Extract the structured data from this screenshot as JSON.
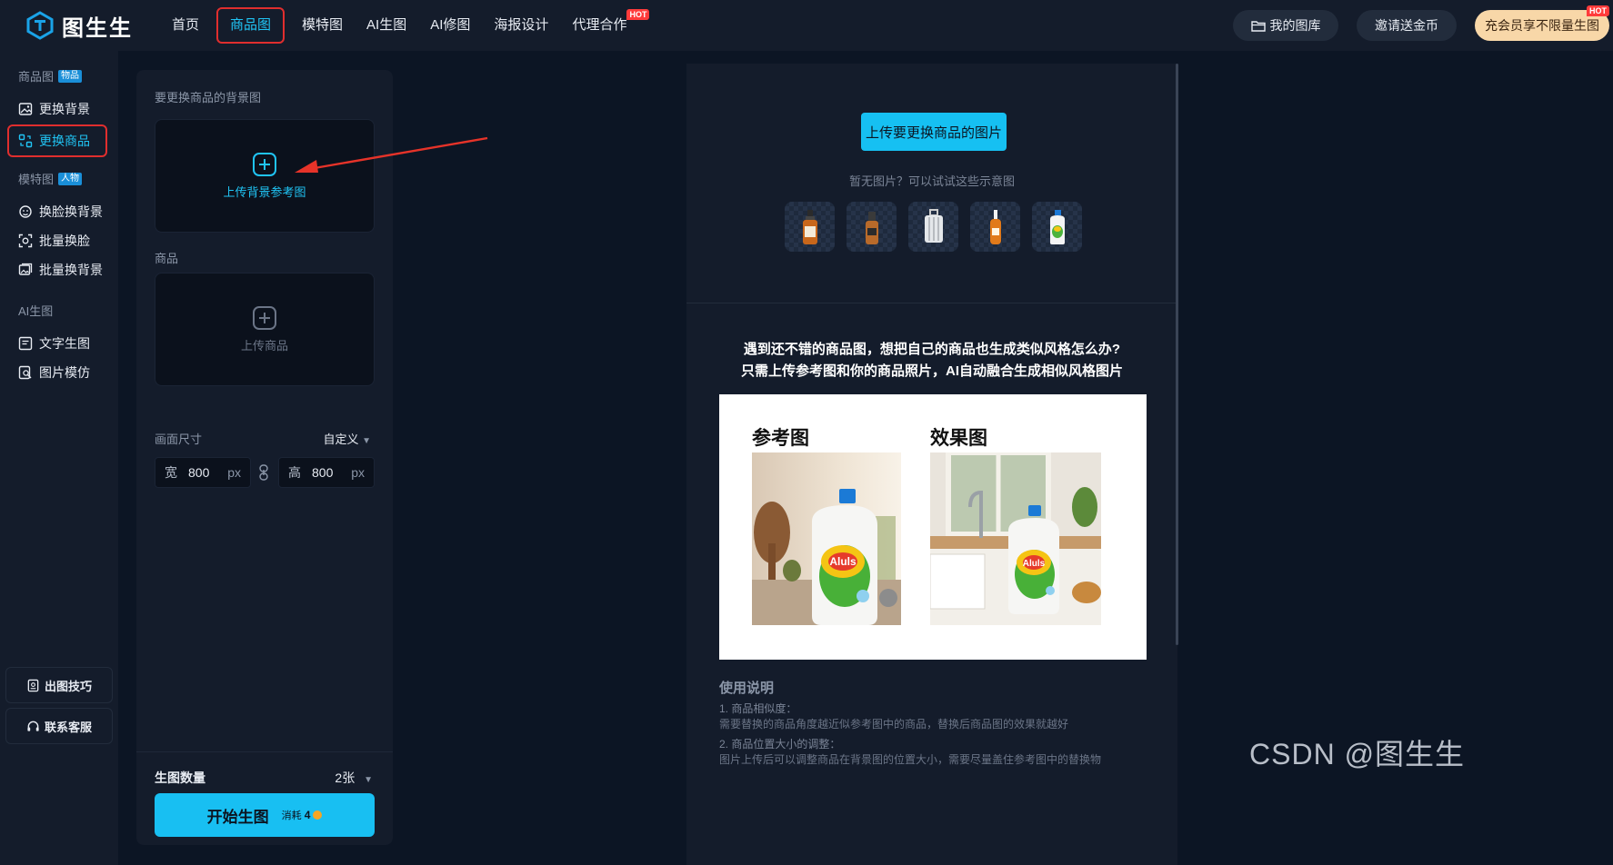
{
  "app": {
    "logo_text": "图生生",
    "brand_color": "#18bff2"
  },
  "nav": {
    "items": [
      "首页",
      "商品图",
      "模特图",
      "AI生图",
      "AI修图",
      "海报设计",
      "代理合作"
    ],
    "active_index": 1,
    "hot_badge": "HOT"
  },
  "top_actions": {
    "library": "我的图库",
    "invite": "邀请送金币",
    "vip": "充会员享不限量生图",
    "vip_badge": "HOT"
  },
  "sidebar": {
    "groups": [
      {
        "label": "商品图",
        "tag": "物品"
      },
      {
        "label": "模特图",
        "tag": "人物"
      },
      {
        "label": "AI生图",
        "tag": ""
      }
    ],
    "items": [
      "更换背景",
      "更换商品",
      "换脸换背景",
      "批量换脸",
      "批量换背景",
      "文字生图",
      "图片模仿"
    ],
    "active_index": 1,
    "bottom": {
      "tips": "出图技巧",
      "support": "联系客服"
    }
  },
  "panel": {
    "bg_label": "要更换商品的背景图",
    "bg_upload": "上传背景参考图",
    "product_label": "商品",
    "product_upload": "上传商品",
    "size_label": "画面尺寸",
    "size_mode": "自定义",
    "width_label": "宽",
    "width_value": "800",
    "height_label": "高",
    "height_value": "800",
    "unit": "px",
    "count_label": "生图数量",
    "count_value": "2张",
    "start_button": "开始生图",
    "cost_label": "消耗",
    "cost_value": "4"
  },
  "preview": {
    "upload_button": "上传要更换商品的图片",
    "hint": "暂无图片？可以试试这些示意图",
    "sample_icons": [
      "dropper-bottle-icon",
      "serum-bottle-icon",
      "suitcase-icon",
      "essence-bottle-icon",
      "detergent-bottle-icon"
    ],
    "desc_line1": "遇到还不错的商品图，想把自己的商品也生成类似风格怎么办?",
    "desc_line2": "只需上传参考图和你的商品照片，AI自动融合生成相似风格图片",
    "demo_ref_title": "参考图",
    "demo_result_title": "效果图",
    "bottle_brand": "Aluls",
    "usage_title": "使用说明",
    "usage": [
      "1. 商品相似度：",
      "需要替换的商品角度越近似参考图中的商品，替换后商品图的效果就越好",
      "2. 商品位置大小的调整：",
      "图片上传后可以调整商品在背景图的位置大小，需要尽量盖住参考图中的替换物"
    ]
  },
  "watermark": "CSDN @图生生"
}
